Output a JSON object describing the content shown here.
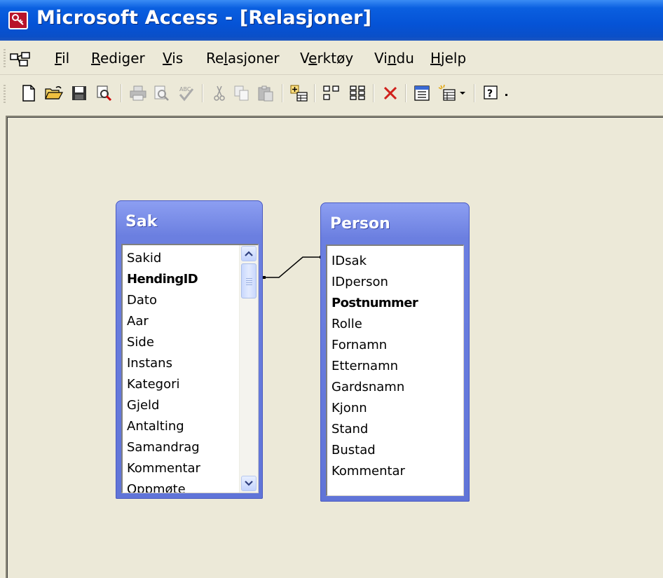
{
  "window": {
    "title": "Microsoft Access - [Relasjoner]"
  },
  "menu": {
    "items": [
      {
        "label": "Fil",
        "underline": "F"
      },
      {
        "label": "Rediger",
        "underline": "R"
      },
      {
        "label": "Vis",
        "underline": "V"
      },
      {
        "label": "Relasjoner",
        "underline": "l"
      },
      {
        "label": "Verktøy",
        "underline": "e"
      },
      {
        "label": "Vindu",
        "underline": "n"
      },
      {
        "label": "Hjelp",
        "underline": "H"
      }
    ]
  },
  "toolbar": {
    "buttons": [
      "new-icon",
      "open-icon",
      "save-icon",
      "search-icon",
      "print-icon",
      "print-preview-icon",
      "spelling-icon",
      "cut-icon",
      "copy-icon",
      "paste-icon",
      "show-table-icon",
      "show-direct-icon",
      "show-all-icon",
      "delete-icon",
      "properties-icon",
      "new-object-icon",
      "help-icon"
    ]
  },
  "tables": {
    "sak": {
      "title": "Sak",
      "fields": [
        "Sakid",
        "HendingID",
        "Dato",
        "Aar",
        "Side",
        "Instans",
        "Kategori",
        "Gjeld",
        "Antalting",
        "Samandrag",
        "Kommentar",
        "Oppmøte"
      ],
      "bold_fields": [
        "HendingID"
      ]
    },
    "person": {
      "title": "Person",
      "fields": [
        "IDsak",
        "IDperson",
        "Postnummer",
        "Rolle",
        "Fornamn",
        "Etternamn",
        "Gardsnamn",
        "Kjonn",
        "Stand",
        "Bustad",
        "Kommentar"
      ],
      "bold_fields": [
        "Postnummer"
      ]
    }
  },
  "relationship": {
    "from": "Sak.HendingID",
    "to": "Person.IDsak"
  },
  "colors": {
    "title_bar": "#0553d6",
    "window_bg": "#ece9d8",
    "table_header": "#6b7fe0"
  }
}
